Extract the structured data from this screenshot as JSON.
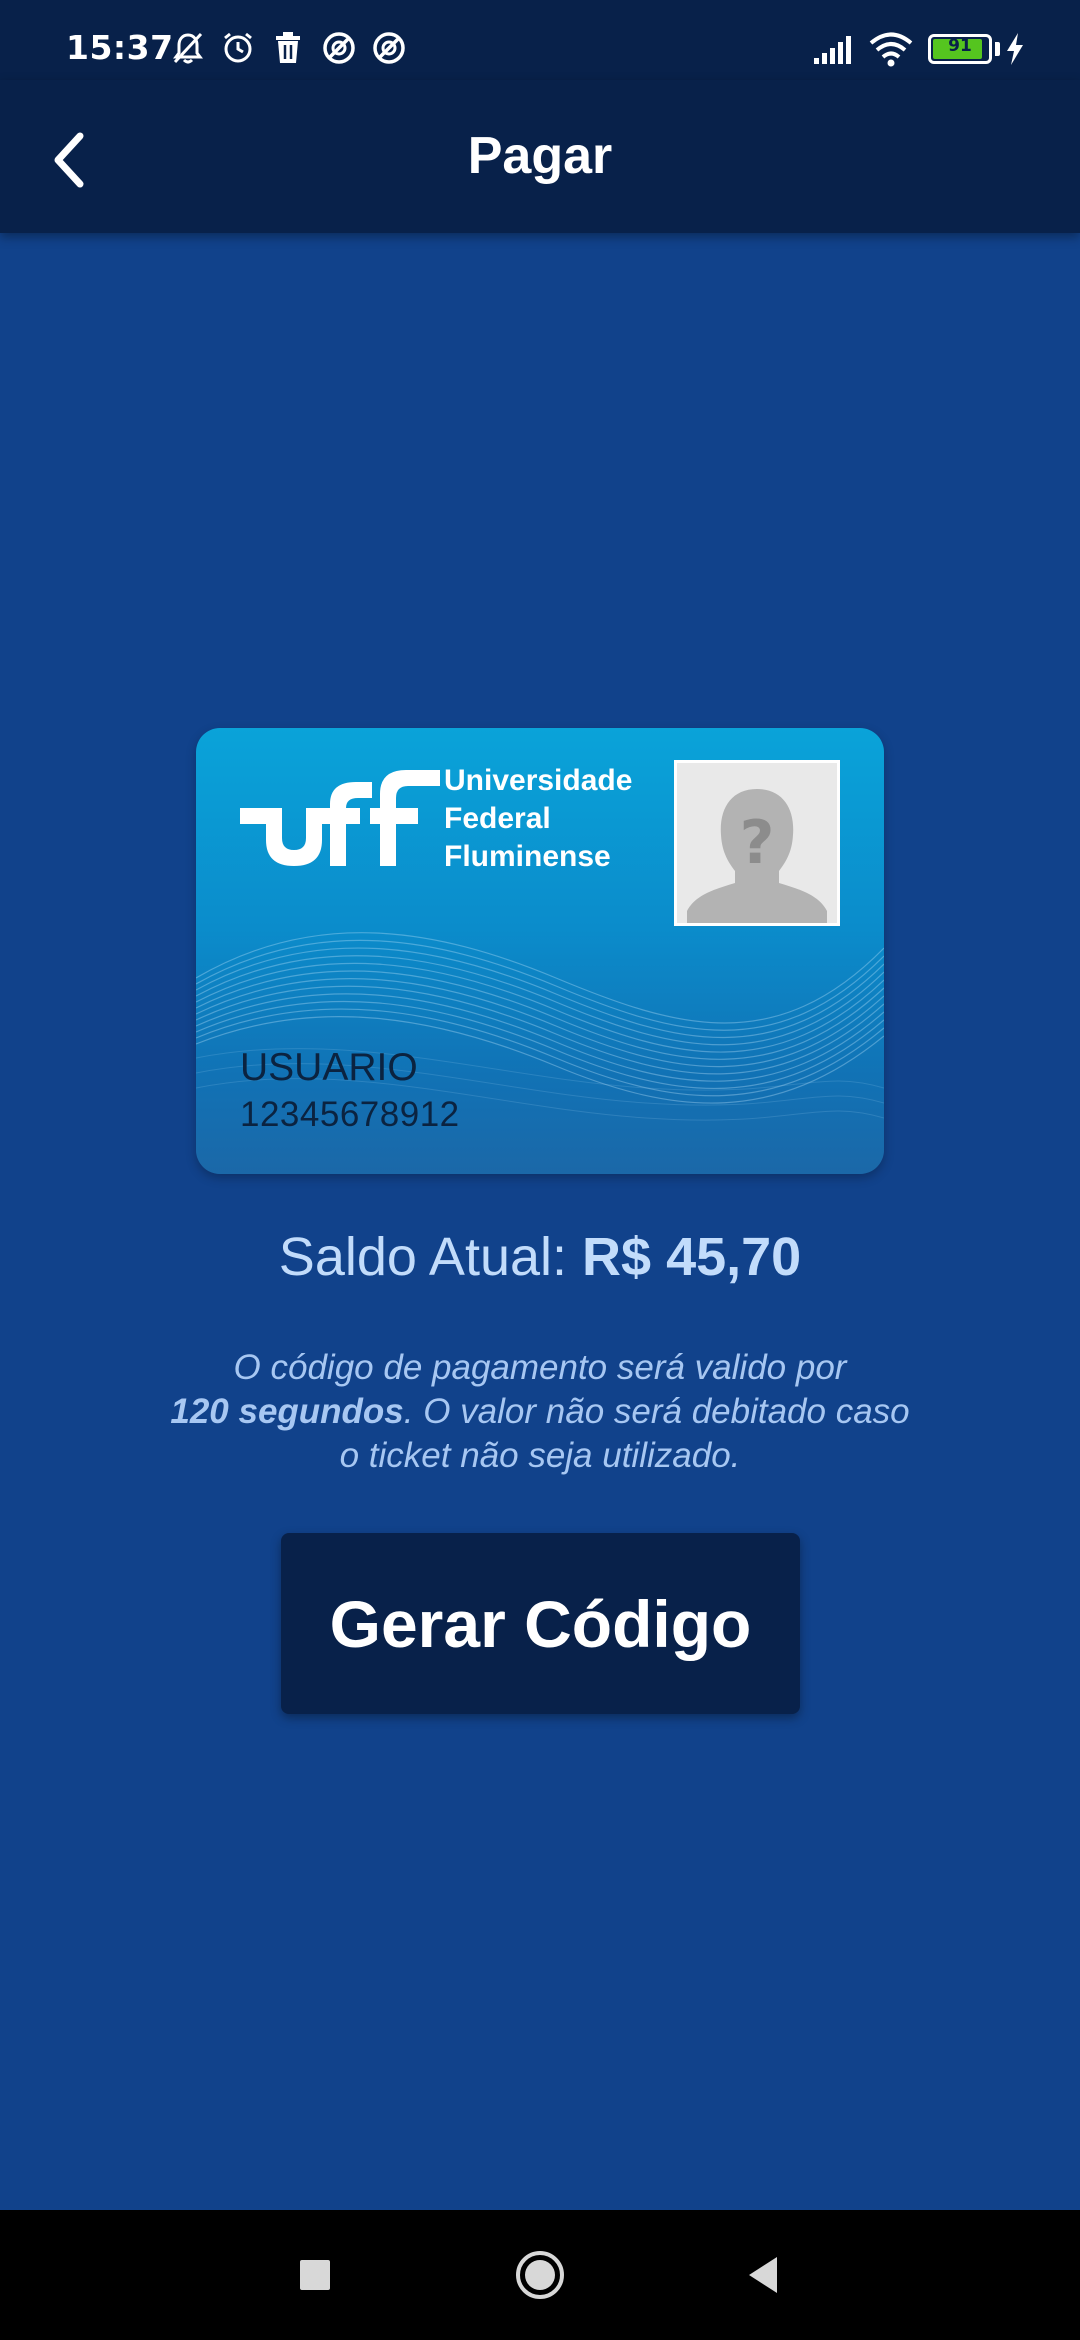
{
  "status_bar": {
    "time": "15:37",
    "battery_level": "91",
    "battery_percent": 91,
    "icons": [
      "muted-bell-icon",
      "alarm-icon",
      "trash-icon",
      "blocked-circle-icon",
      "blocked-circle-icon",
      "signal-icon",
      "wifi-icon",
      "battery-icon",
      "charging-bolt-icon"
    ]
  },
  "app_bar": {
    "title": "Pagar",
    "back_icon": "chevron-left-icon"
  },
  "card": {
    "logo_text": "uff",
    "university_line1": "Universidade",
    "university_line2": "Federal",
    "university_line3": "Fluminense",
    "user_name": "USUARIO",
    "user_number": "12345678912"
  },
  "balance": {
    "label": "Saldo Atual: ",
    "value": "R$ 45,70"
  },
  "info": {
    "part1": "O código de pagamento será valido por",
    "strong": "120 segundos",
    "part2": ". O valor não será debitado caso o ticket não seja utilizado."
  },
  "action": {
    "button_label": "Gerar Código"
  },
  "nav": {
    "recent_icon": "square-icon",
    "home_icon": "circle-icon",
    "back_icon": "triangle-back-icon"
  },
  "colors": {
    "background": "#11428b",
    "bar": "#08214a",
    "card_top": "#0aa3d9",
    "balance_text": "#c2dcfb",
    "info_text": "#a7c7f2",
    "battery_fill": "#55c51f"
  }
}
